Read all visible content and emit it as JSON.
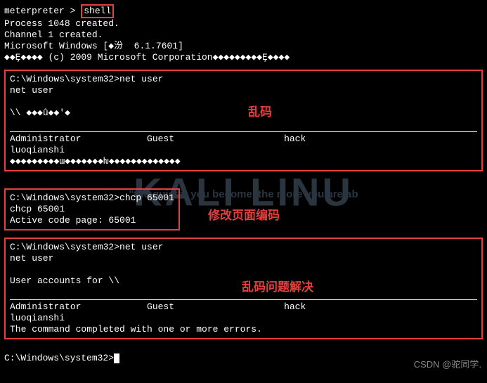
{
  "watermark": {
    "main": "KALI LINU",
    "sub": "\"the quieter you become, the more you are ab"
  },
  "intro": {
    "prompt_prefix": "meterpreter",
    "prompt_gt": " > ",
    "shell_cmd": "shell",
    "process": "Process 1048 created.",
    "channel": "Channel 1 created.",
    "winver": "Microsoft Windows [◆汾  6.1.7601]",
    "copyright": "◆◆Ȩ◆◆◆◆ (c) 2009 Microsoft Corporation◆◆◆◆◆◆◆◆◆Ȩ◆◆◆◆"
  },
  "box1": {
    "cmd_line": "C:\\Windows\\system32>net user",
    "echo": "net user",
    "garbage": "\\\\ ◆◆◆û◆◆'◆",
    "users": "Administrator            Guest                    hack",
    "user2": "luoqianshi",
    "garbage2": "◆◆◆◆◆◆◆◆◆ɯ◆◆◆◆◆◆◆ƕ◆◆◆◆◆◆◆◆◆◆◆◆◆"
  },
  "box2": {
    "cmd_line": "C:\\Windows\\system32>chcp 65001",
    "echo": "chcp 65001",
    "result": "Active code page: 65001"
  },
  "box3": {
    "cmd_line": "C:\\Windows\\system32>net user",
    "echo": "net user",
    "accounts": "User accounts for \\\\",
    "users": "Administrator            Guest                    hack",
    "user2": "luoqianshi",
    "result": "The command completed with one or more errors."
  },
  "final_prompt": "C:\\Windows\\system32>",
  "annotations": {
    "a1": "乱码",
    "a2": "修改页面编码",
    "a3": "乱码问题解决"
  },
  "csdn": "CSDN @驼同学."
}
